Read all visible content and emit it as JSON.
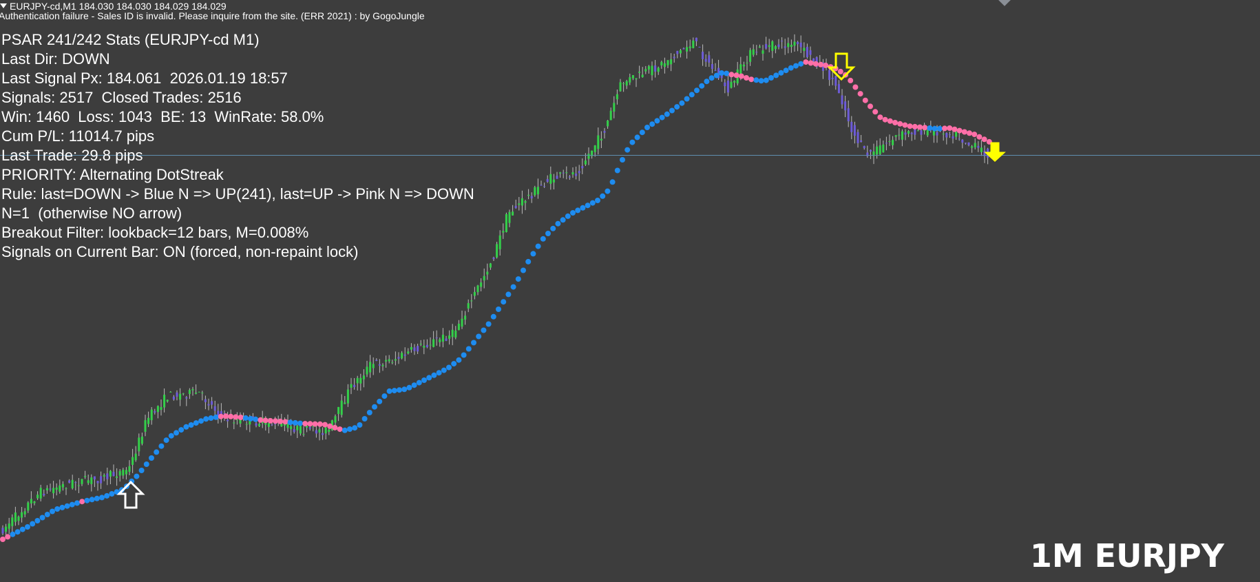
{
  "window": {
    "symbol_line": "EURJPY-cd,M1  184.030 184.030 184.029 184.029",
    "alert_line": "Authentication failure - Sales ID is invalid. Please inquire from the site. (ERR 2021) : by GogoJungle"
  },
  "stats": {
    "lines": [
      "PSAR 241/242 Stats (EURJPY-cd M1)",
      "Last Dir: DOWN",
      "Last Signal Px: 184.061  2026.01.19 18:57",
      "Signals: 2517  Closed Trades: 2516",
      "Win: 1460  Loss: 1043  BE: 13  WinRate: 58.0%",
      "Cum P/L: 11014.7 pips",
      "Last Trade: 29.8 pips",
      "PRIORITY: Alternating DotStreak",
      "Rule: last=DOWN -> Blue N => UP(241), last=UP -> Pink N => DOWN",
      "N=1  (otherwise NO arrow)",
      "Breakout Filter: lookback=12 bars, M=0.008%",
      "Signals on Current Bar: ON (forced, non-repaint lock)"
    ]
  },
  "watermark": "1M EURJPY",
  "colors": {
    "background": "#3d3d3d",
    "bull_candle": "#34d04a",
    "bear_candle": "#6d5bd8",
    "psar_blue": "#1e8cf0",
    "psar_pink": "#ff6fa8",
    "price_line": "#5f8fb0",
    "signal_down": "#ffff00",
    "signal_up": "#ffffff"
  },
  "icons": {
    "up_signal": "hollow-up-arrow-icon",
    "down_signal_hollow": "hollow-down-arrow-icon",
    "down_signal_current": "solid-down-arrow-icon"
  }
}
